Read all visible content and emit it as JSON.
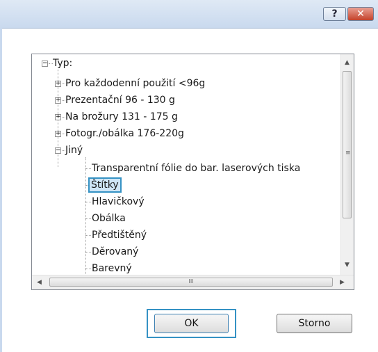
{
  "title_bar": {
    "help_label": "?",
    "close_label": "✕"
  },
  "tree": {
    "root_label": "Typ:",
    "root_expander": "−",
    "items": [
      {
        "label": "Pro každodenní použití <96g",
        "expander": "+"
      },
      {
        "label": "Prezentační 96 - 130 g",
        "expander": "+"
      },
      {
        "label": "Na brožury 131 - 175 g",
        "expander": "+"
      },
      {
        "label": "Fotogr./obálka 176-220g",
        "expander": "+"
      },
      {
        "label": "Jiný",
        "expander": "−"
      }
    ],
    "children": [
      {
        "label": "Transparentní fólie do bar. laserových tiska"
      },
      {
        "label": "Štítky",
        "selected": true
      },
      {
        "label": "Hlavičkový"
      },
      {
        "label": "Obálka"
      },
      {
        "label": "Předtištěný"
      },
      {
        "label": "Děrovaný"
      },
      {
        "label": "Barevný"
      }
    ]
  },
  "scrollbars": {
    "vertical_up": "▲",
    "vertical_down": "▼",
    "vertical_grip": "≡",
    "horizontal_left": "◀",
    "horizontal_right": "▶",
    "horizontal_grip": "III"
  },
  "buttons": {
    "ok_label": "OK",
    "cancel_label": "Storno"
  },
  "colors": {
    "selection_border": "#3592c4",
    "title_bar": "#c9d9ee",
    "close_button": "#c4422b"
  }
}
